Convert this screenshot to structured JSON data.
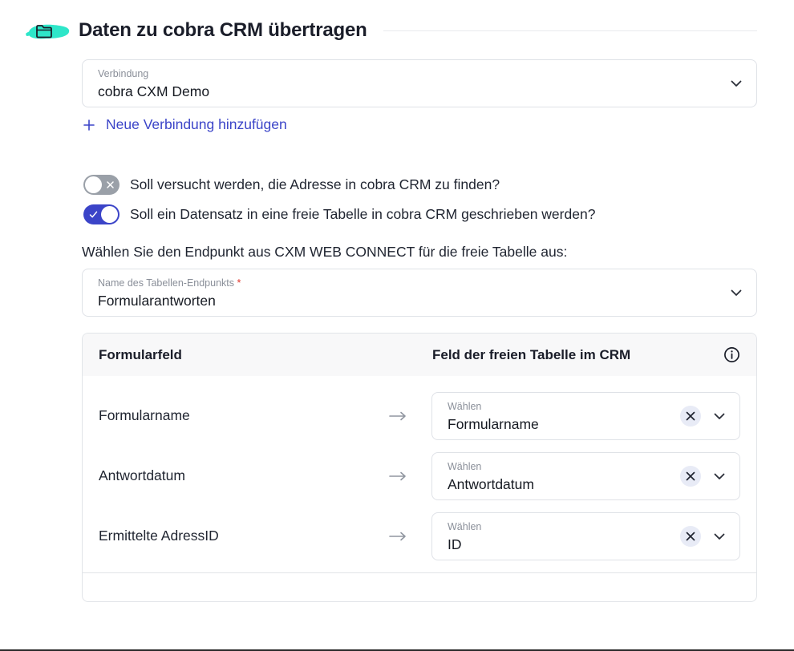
{
  "header": {
    "title": "Daten zu cobra CRM übertragen",
    "icon": "folder-icon",
    "highlight_color": "#2ee6c9"
  },
  "connection": {
    "label": "Verbindung",
    "value": "cobra CXM Demo",
    "add_label": "Neue Verbindung hinzufügen"
  },
  "toggles": [
    {
      "text": "Soll versucht werden, die Adresse in cobra CRM zu finden?",
      "state": "off"
    },
    {
      "text": "Soll ein Datensatz in eine freie Tabelle in cobra CRM geschrieben werden?",
      "state": "on"
    }
  ],
  "endpoint": {
    "instruction": "Wählen Sie den Endpunkt aus CXM WEB CONNECT für die freie Tabelle aus:",
    "label": "Name des Tabellen-Endpunkts",
    "required_mark": "*",
    "value": "Formularantworten"
  },
  "mapping": {
    "col_form_field": "Formularfeld",
    "col_table_field": "Feld der freien Tabelle im CRM",
    "rows": [
      {
        "form_field": "Formularname",
        "select_label": "Wählen",
        "table_field": "Formularname"
      },
      {
        "form_field": "Antwortdatum",
        "select_label": "Wählen",
        "table_field": "Antwortdatum"
      },
      {
        "form_field": "Ermittelte AdressID",
        "select_label": "Wählen",
        "table_field": "ID"
      }
    ]
  },
  "colors": {
    "accent": "#3b44c8",
    "toggle_off": "#9aa0a8",
    "required": "#e0352b"
  }
}
